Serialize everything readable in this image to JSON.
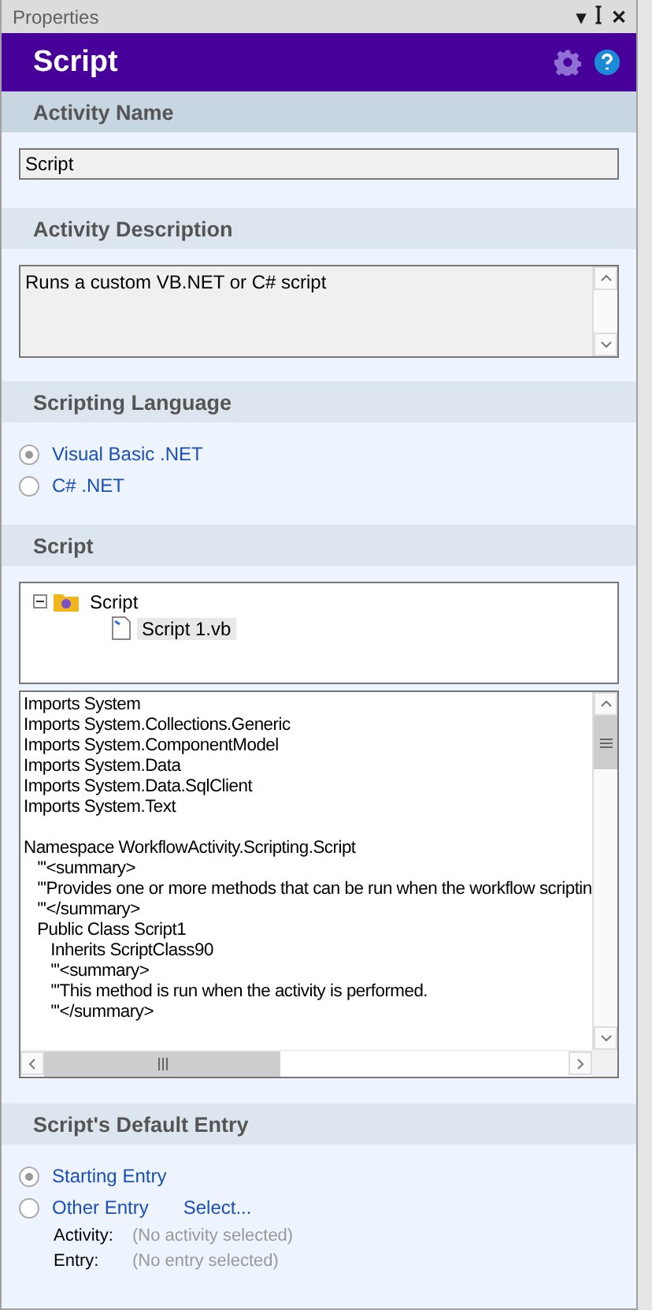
{
  "panel": {
    "title": "Properties",
    "buttons": [
      "▾",
      "ꟾ",
      "✕"
    ]
  },
  "header": {
    "title": "Script"
  },
  "sections": [
    {
      "kind": "name",
      "title": "Activity Name",
      "value": "Script"
    },
    {
      "kind": "description",
      "title": "Activity Description",
      "value": "Runs a custom VB.NET or C# script"
    },
    {
      "kind": "language",
      "title": "Scripting Language",
      "options": [
        {
          "label": "Visual Basic .NET",
          "selected": true
        },
        {
          "label": "C# .NET",
          "selected": false
        }
      ]
    },
    {
      "kind": "script",
      "title": "Script",
      "tree": [
        {
          "label": "Script",
          "expanded": true,
          "selected": false,
          "children": [
            {
              "label": "Script 1.vb",
              "selected": true
            }
          ]
        }
      ],
      "code": [
        [
          "Imports System",
          "Imports System.Collections.Generic",
          "Imports System.ComponentModel",
          "Imports System.Data",
          "Imports System.Data.SqlClient",
          "Imports System.Text"
        ],
        [
          "Namespace WorkflowActivity.Scripting.Script",
          "   '''<summary>",
          "   '''Provides one or more methods that can be run when the workflow scriptin",
          "   '''</summary>",
          "   Public Class Script1",
          "      Inherits ScriptClass90",
          "      '''<summary>",
          "      '''This method is run when the activity is performed.",
          "      '''</summary>"
        ]
      ]
    },
    {
      "kind": "entry",
      "title": "Script's Default Entry",
      "options": [
        {
          "label": "Starting Entry",
          "selected": true
        },
        {
          "label": "Other Entry",
          "selected": false,
          "link": "Select..."
        }
      ],
      "details": [
        {
          "label": "Activity:",
          "value": "(No activity selected)"
        },
        {
          "label": "Entry:",
          "value": "(No entry selected)"
        }
      ]
    }
  ]
}
